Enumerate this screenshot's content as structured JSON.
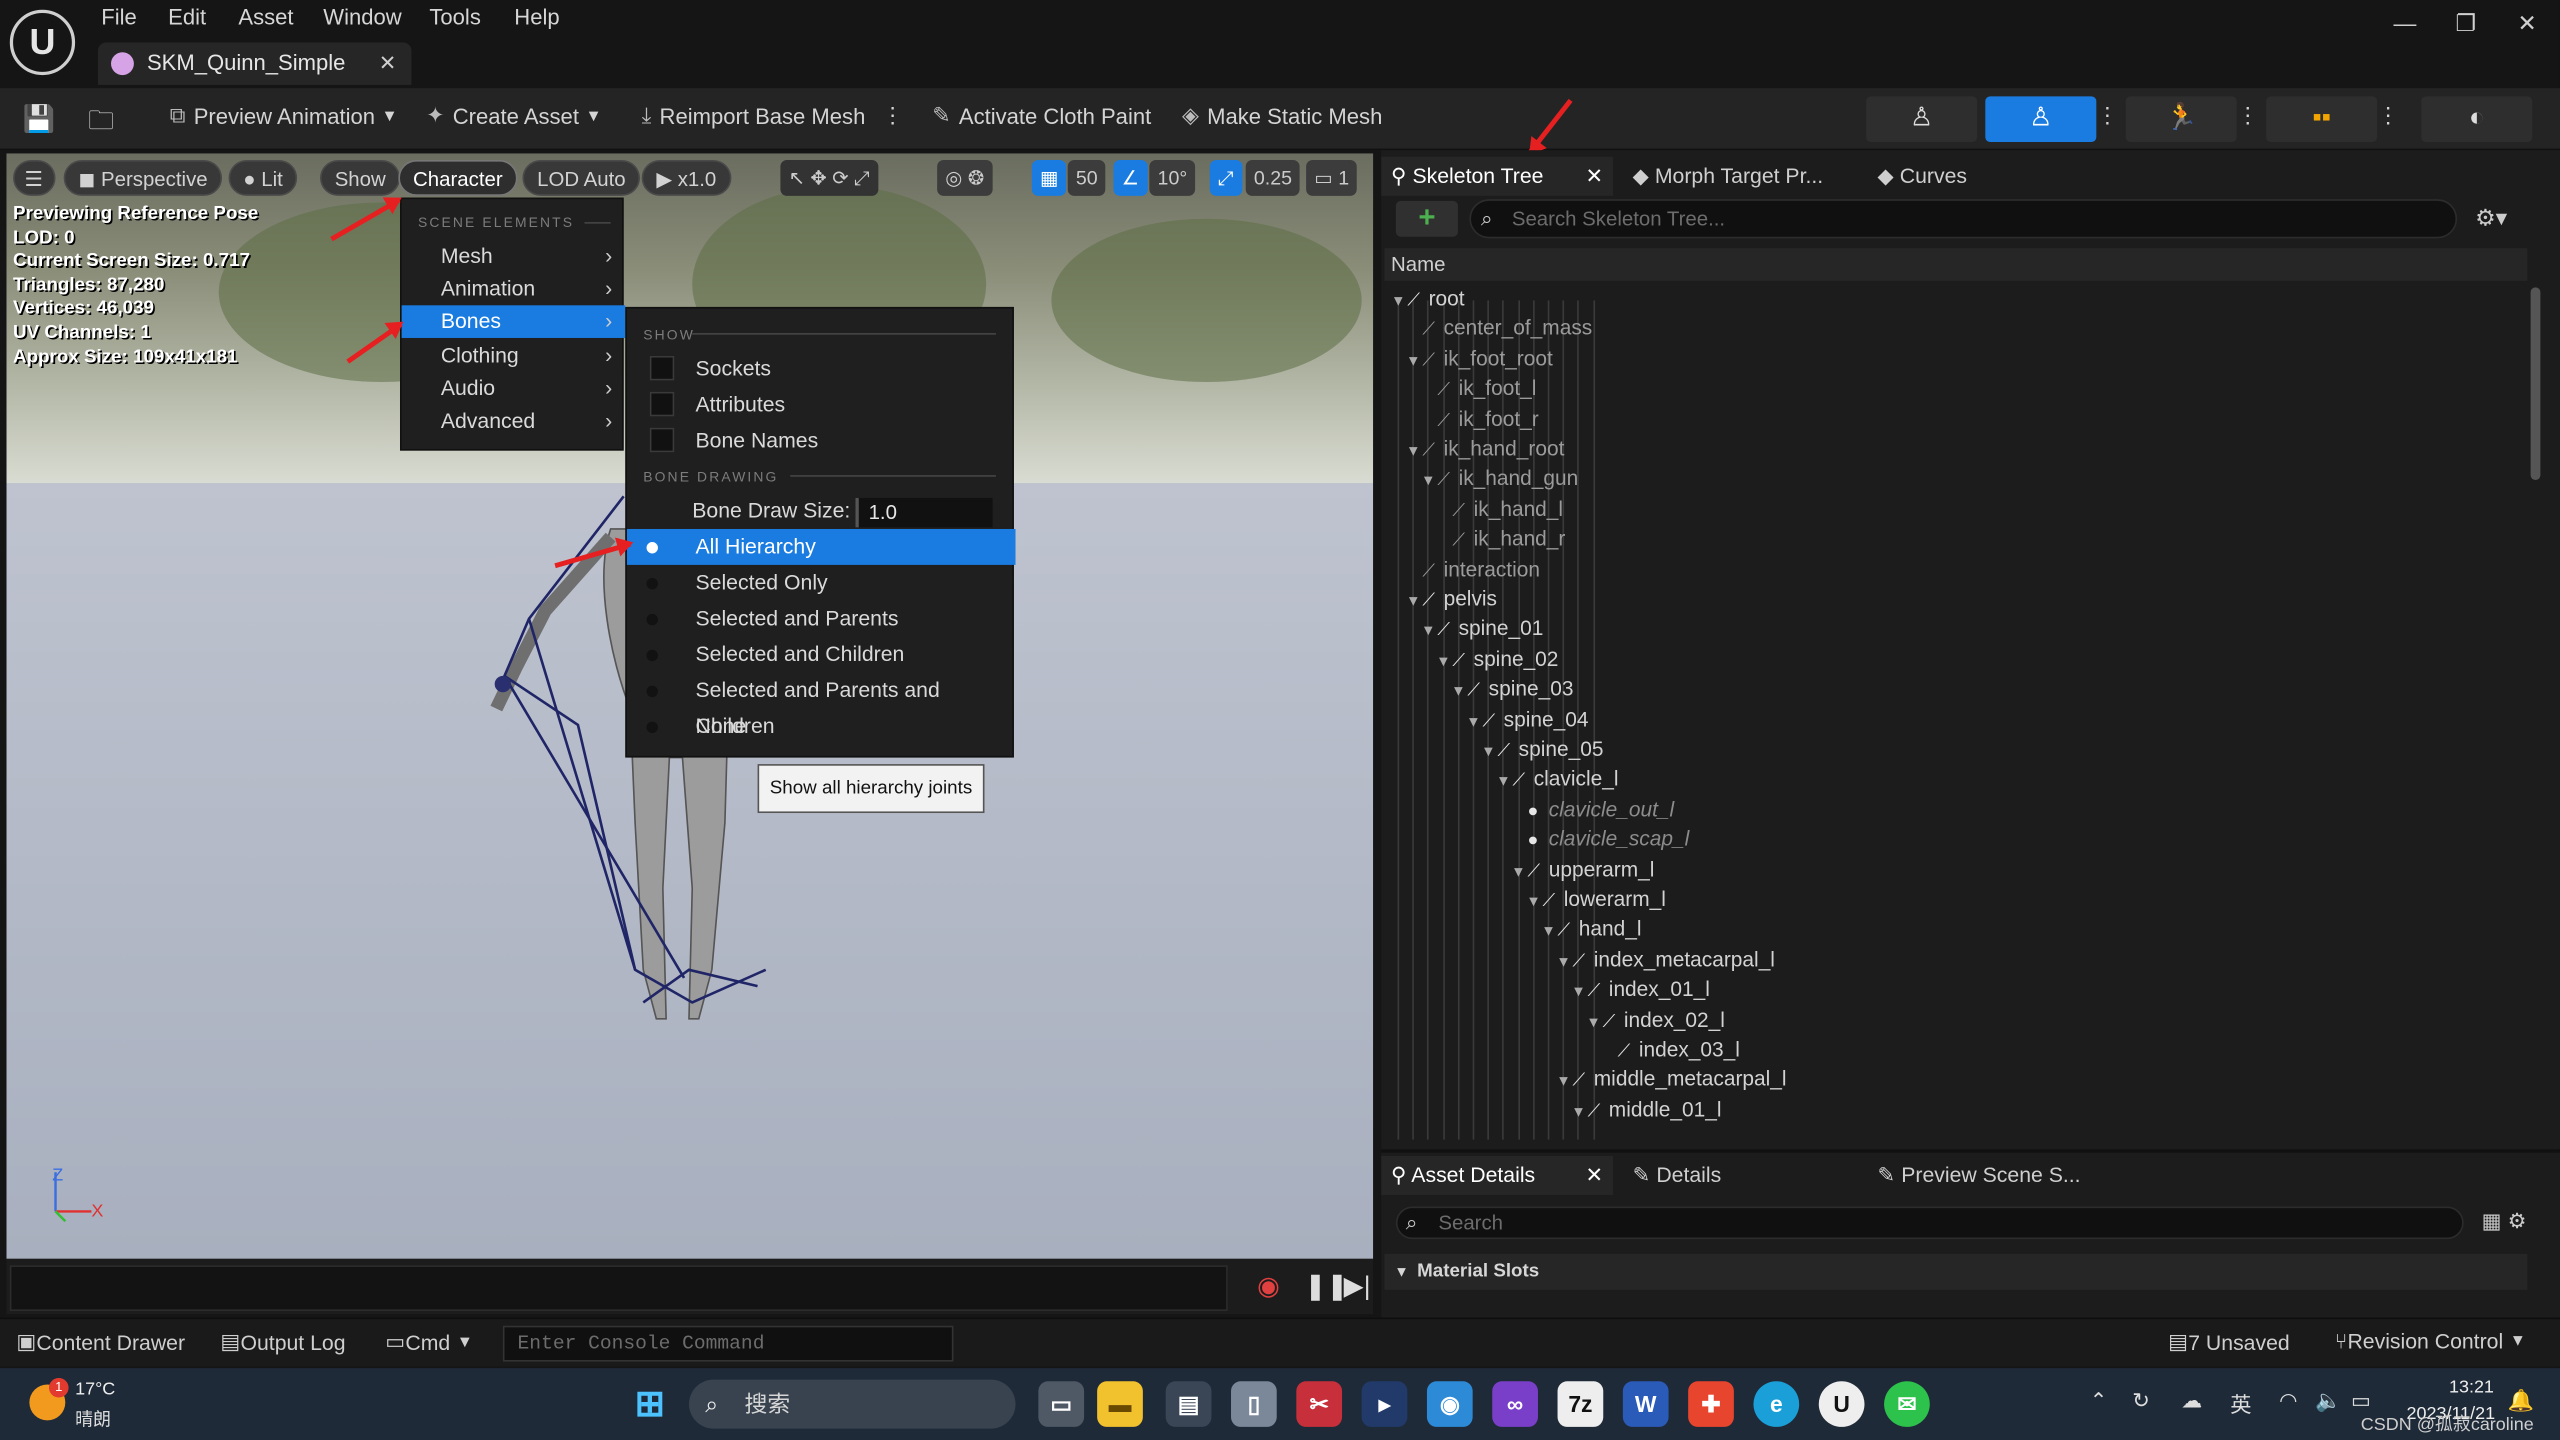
{
  "menubar": {
    "items": [
      "File",
      "Edit",
      "Asset",
      "Window",
      "Tools",
      "Help"
    ]
  },
  "asset_tab": {
    "title": "SKM_Quinn_Simple"
  },
  "toolbar": {
    "preview_animation": "Preview Animation",
    "create_asset": "Create Asset",
    "reimport": "Reimport Base Mesh",
    "cloth_paint": "Activate Cloth Paint",
    "make_static": "Make Static Mesh"
  },
  "viewport": {
    "perspective": "Perspective",
    "lit": "Lit",
    "show": "Show",
    "character": "Character",
    "lod": "LOD Auto",
    "play_rate": "x1.0",
    "grid_snap": "50",
    "rot_snap": "10°",
    "scale_snap": "0.25",
    "cam_speed": "1",
    "stats": [
      "Previewing Reference Pose",
      "LOD: 0",
      "Current Screen Size: 0.717",
      "Triangles: 87,280",
      "Vertices: 46,039",
      "UV Channels: 1",
      "Approx Size: 109x41x181"
    ],
    "axis_z": "Z",
    "axis_x": "X"
  },
  "character_menu": {
    "section": "SCENE ELEMENTS",
    "items": [
      "Mesh",
      "Animation",
      "Bones",
      "Clothing",
      "Audio",
      "Advanced"
    ],
    "selected": "Bones"
  },
  "bones_menu": {
    "show_header": "SHOW",
    "checkboxes": [
      "Sockets",
      "Attributes",
      "Bone Names"
    ],
    "drawing_header": "BONE DRAWING",
    "bone_draw_size_label": "Bone Draw Size:",
    "bone_draw_size_value": "1.0",
    "options": [
      "All Hierarchy",
      "Selected Only",
      "Selected and Parents",
      "Selected and Children",
      "Selected and Parents and Children",
      "None"
    ],
    "selected_option": "All Hierarchy",
    "tooltip": "Show all hierarchy joints"
  },
  "right_panel": {
    "tabs": [
      "Skeleton Tree",
      "Morph Target Pr...",
      "Curves"
    ],
    "search_placeholder": "Search Skeleton Tree...",
    "name_header": "Name",
    "bones": [
      {
        "name": "root",
        "depth": 0,
        "expanded": true,
        "style": "normal"
      },
      {
        "name": "center_of_mass",
        "depth": 1,
        "expanded": false,
        "style": "dim"
      },
      {
        "name": "ik_foot_root",
        "depth": 1,
        "expanded": true,
        "style": "dim"
      },
      {
        "name": "ik_foot_l",
        "depth": 2,
        "expanded": false,
        "style": "dim"
      },
      {
        "name": "ik_foot_r",
        "depth": 2,
        "expanded": false,
        "style": "dim"
      },
      {
        "name": "ik_hand_root",
        "depth": 1,
        "expanded": true,
        "style": "dim"
      },
      {
        "name": "ik_hand_gun",
        "depth": 2,
        "expanded": true,
        "style": "dim"
      },
      {
        "name": "ik_hand_l",
        "depth": 3,
        "expanded": false,
        "style": "dim"
      },
      {
        "name": "ik_hand_r",
        "depth": 3,
        "expanded": false,
        "style": "dim"
      },
      {
        "name": "interaction",
        "depth": 1,
        "expanded": false,
        "style": "dim"
      },
      {
        "name": "pelvis",
        "depth": 1,
        "expanded": true,
        "style": "normal"
      },
      {
        "name": "spine_01",
        "depth": 2,
        "expanded": true,
        "style": "normal"
      },
      {
        "name": "spine_02",
        "depth": 3,
        "expanded": true,
        "style": "normal"
      },
      {
        "name": "spine_03",
        "depth": 4,
        "expanded": true,
        "style": "normal"
      },
      {
        "name": "spine_04",
        "depth": 5,
        "expanded": true,
        "style": "normal"
      },
      {
        "name": "spine_05",
        "depth": 6,
        "expanded": true,
        "style": "normal"
      },
      {
        "name": "clavicle_l",
        "depth": 7,
        "expanded": true,
        "style": "normal"
      },
      {
        "name": "clavicle_out_l",
        "depth": 8,
        "expanded": false,
        "style": "italic"
      },
      {
        "name": "clavicle_scap_l",
        "depth": 8,
        "expanded": false,
        "style": "italic"
      },
      {
        "name": "upperarm_l",
        "depth": 8,
        "expanded": true,
        "style": "normal"
      },
      {
        "name": "lowerarm_l",
        "depth": 9,
        "expanded": true,
        "style": "normal"
      },
      {
        "name": "hand_l",
        "depth": 10,
        "expanded": true,
        "style": "normal"
      },
      {
        "name": "index_metacarpal_l",
        "depth": 11,
        "expanded": true,
        "style": "normal"
      },
      {
        "name": "index_01_l",
        "depth": 12,
        "expanded": true,
        "style": "normal"
      },
      {
        "name": "index_02_l",
        "depth": 13,
        "expanded": true,
        "style": "normal"
      },
      {
        "name": "index_03_l",
        "depth": 14,
        "expanded": false,
        "style": "normal"
      },
      {
        "name": "middle_metacarpal_l",
        "depth": 11,
        "expanded": true,
        "style": "normal"
      },
      {
        "name": "middle_01_l",
        "depth": 12,
        "expanded": true,
        "style": "normal"
      }
    ]
  },
  "details_panel": {
    "tabs": [
      "Asset Details",
      "Details",
      "Preview Scene S..."
    ],
    "search_placeholder": "Search",
    "section": "Material Slots"
  },
  "statusbar": {
    "content_drawer": "Content Drawer",
    "output_log": "Output Log",
    "cmd": "Cmd",
    "console_placeholder": "Enter Console Command",
    "unsaved": "7 Unsaved",
    "revision": "Revision Control"
  },
  "taskbar": {
    "weather_temp": "17°C",
    "weather_desc": "晴朗",
    "weather_badge": "1",
    "search": "搜索",
    "lang": "英",
    "time": "13:21",
    "date": "2023/11/21",
    "watermark": "CSDN @孤寂caroline"
  }
}
